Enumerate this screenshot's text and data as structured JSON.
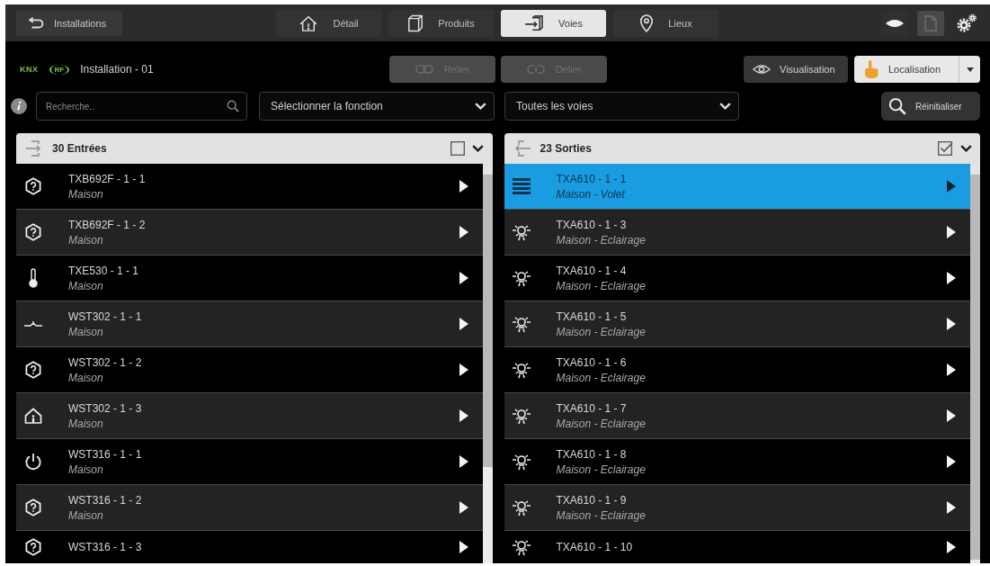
{
  "top_bar": {
    "back_button": {
      "label": "Installations"
    },
    "tabs": [
      {
        "label": "Détail",
        "selected": false
      },
      {
        "label": "Produits",
        "selected": false
      },
      {
        "label": "Voies",
        "selected": true
      },
      {
        "label": "Lieux",
        "selected": false
      }
    ]
  },
  "installation": {
    "logos": [
      {
        "kind": "knx",
        "text": "KNX"
      },
      {
        "kind": "rf",
        "text": "RF"
      }
    ],
    "name": "Installation - 01"
  },
  "link_buttons": [
    {
      "label": "Relier",
      "disabled": true
    },
    {
      "label": "Délier",
      "disabled": true
    }
  ],
  "view_modes": [
    {
      "label": "Visualisation",
      "selected": false
    },
    {
      "label": "Localisation",
      "selected": true
    }
  ],
  "filters": {
    "search": {
      "placeholder": "Recherche.."
    },
    "function_select": {
      "value": "Sélectionner la fonction"
    },
    "channel_select": {
      "value": "Toutes les voies"
    },
    "reset_button": {
      "label": "Réinitialiser"
    }
  },
  "panels": [
    {
      "title": "30 Entrées",
      "checked": false,
      "rows": [
        {
          "kind": "unknown",
          "title": "TXB692F - 1 - 1",
          "subtitle": "Maison",
          "selected": false
        },
        {
          "kind": "unknown",
          "title": "TXB692F - 1 - 2",
          "subtitle": "Maison",
          "selected": false
        },
        {
          "kind": "thermometer",
          "title": "TXE530 - 1 - 1",
          "subtitle": "Maison",
          "selected": false
        },
        {
          "kind": "pushbutton",
          "title": "WST302 - 1 - 1",
          "subtitle": "Maison",
          "selected": false
        },
        {
          "kind": "unknown",
          "title": "WST302 - 1 - 2",
          "subtitle": "Maison",
          "selected": false
        },
        {
          "kind": "presence",
          "title": "WST302 - 1 - 3",
          "subtitle": "Maison",
          "selected": false
        },
        {
          "kind": "power",
          "title": "WST316 - 1 - 1",
          "subtitle": "Maison",
          "selected": false
        },
        {
          "kind": "unknown",
          "title": "WST316 - 1 - 2",
          "subtitle": "Maison",
          "selected": false
        },
        {
          "kind": "unknown",
          "title": "WST316 - 1 - 3",
          "selected": false
        }
      ]
    },
    {
      "title": "23 Sorties",
      "checked": true,
      "rows": [
        {
          "kind": "shutter",
          "title": "TXA610 - 1 - 1",
          "subtitle": "Maison - Volet",
          "selected": true
        },
        {
          "kind": "light",
          "title": "TXA610 - 1 - 3",
          "subtitle": "Maison - Eclairage",
          "selected": false
        },
        {
          "kind": "light",
          "title": "TXA610 - 1 - 4",
          "subtitle": "Maison - Eclairage",
          "selected": false
        },
        {
          "kind": "light",
          "title": "TXA610 - 1 - 5",
          "subtitle": "Maison - Eclairage",
          "selected": false
        },
        {
          "kind": "light",
          "title": "TXA610 - 1 - 6",
          "subtitle": "Maison - Eclairage",
          "selected": false
        },
        {
          "kind": "light",
          "title": "TXA610 - 1 - 7",
          "subtitle": "Maison - Eclairage",
          "selected": false
        },
        {
          "kind": "light",
          "title": "TXA610 - 1 - 8",
          "subtitle": "Maison - Eclairage",
          "selected": false
        },
        {
          "kind": "light",
          "title": "TXA610 - 1 - 9",
          "subtitle": "Maison - Eclairage",
          "selected": false
        },
        {
          "kind": "light",
          "title": "TXA610 - 1 - 10",
          "selected": false
        }
      ]
    }
  ]
}
